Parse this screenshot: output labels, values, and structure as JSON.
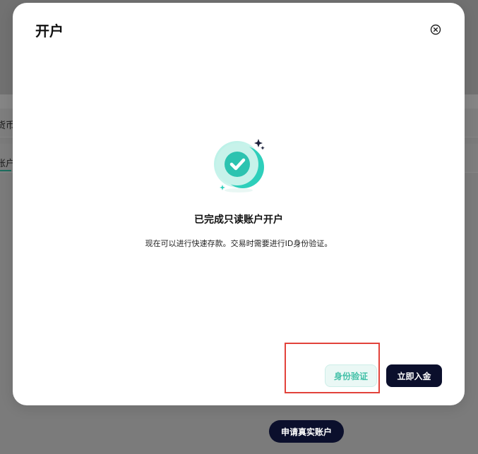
{
  "background": {
    "left_text_1": "货币",
    "left_text_2": "账户",
    "apply_button": "申请真实账户"
  },
  "modal": {
    "title": "开户",
    "close_icon": "close-circle-icon",
    "illustration_icon": "success-check-icon",
    "heading": "已完成只读账户开户",
    "description": "现在可以进行快速存款。交易时需要进行ID身份验证。",
    "buttons": {
      "verify_label": "身份验证",
      "deposit_label": "立即入金"
    }
  },
  "colors": {
    "accent_teal": "#3fbfa6",
    "primary_dark": "#0b0f2c",
    "highlight_red": "#e2423b"
  }
}
